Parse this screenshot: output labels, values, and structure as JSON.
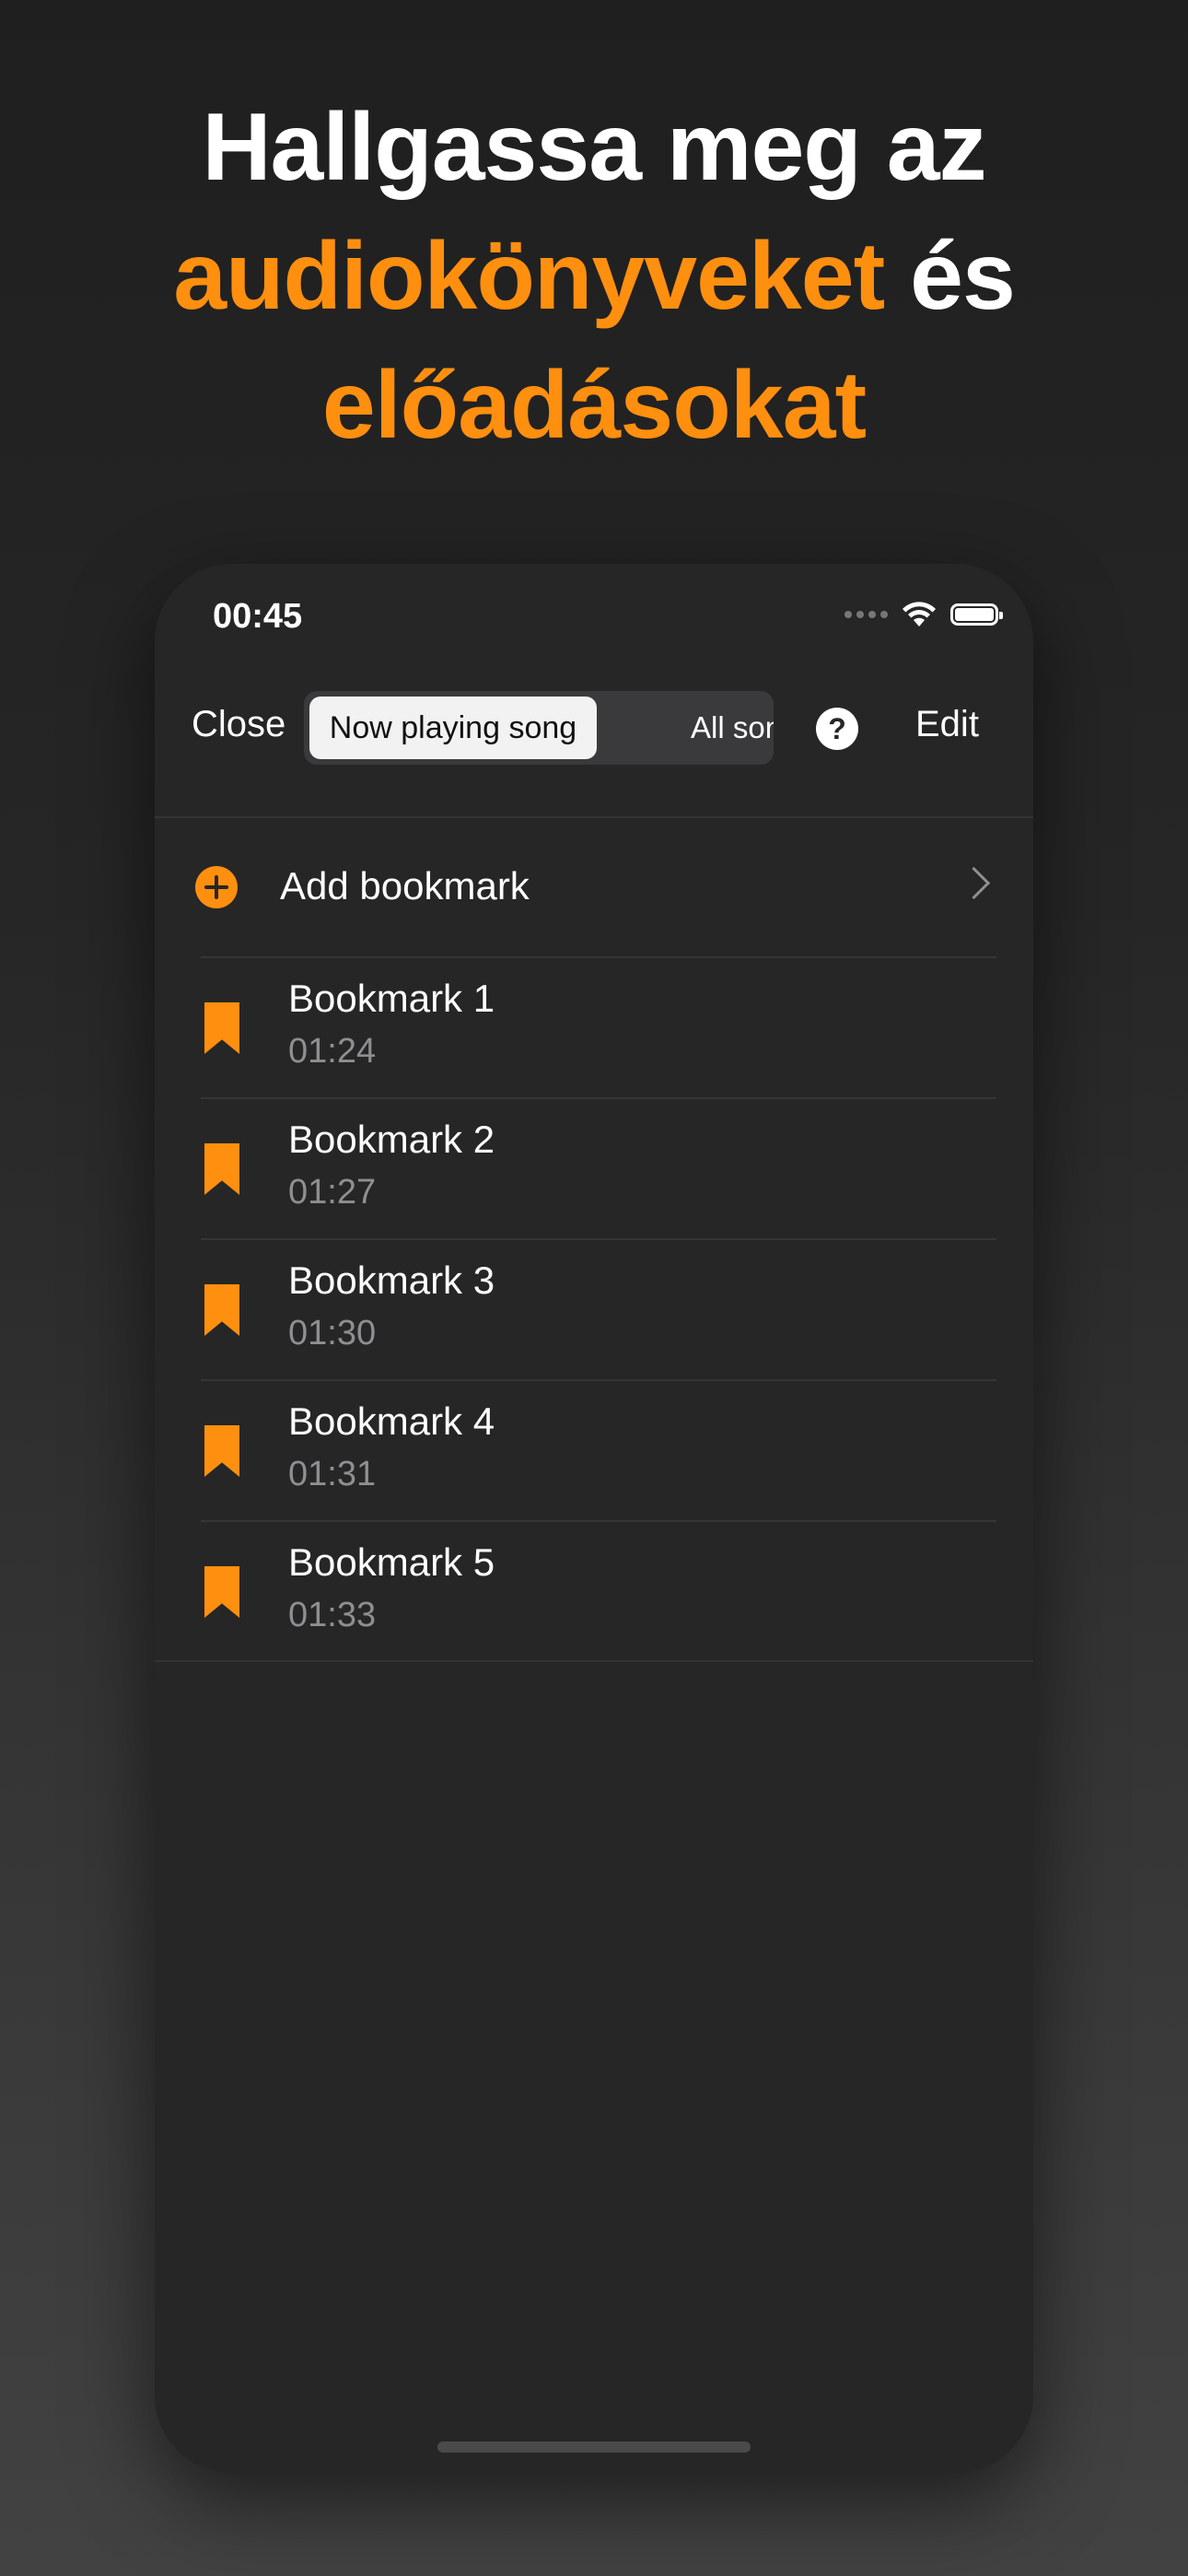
{
  "headline": {
    "line1": "Hallgassa meg az",
    "accent1": "audiokönyveket",
    "connector": " és",
    "accent2": "előadásokat"
  },
  "status_bar": {
    "time": "00:45"
  },
  "navbar": {
    "close_label": "Close",
    "segments": [
      "Now playing song",
      "All songs"
    ],
    "selected_segment": "Now playing song",
    "help_label": "?",
    "edit_label": "Edit"
  },
  "add_bookmark": {
    "label": "Add bookmark"
  },
  "bookmarks": [
    {
      "title": "Bookmark 1",
      "time": "01:24"
    },
    {
      "title": "Bookmark 2",
      "time": "01:27"
    },
    {
      "title": "Bookmark 3",
      "time": "01:30"
    },
    {
      "title": "Bookmark 4",
      "time": "01:31"
    },
    {
      "title": "Bookmark 5",
      "time": "01:33"
    }
  ],
  "colors": {
    "accent": "#ff8f0f",
    "panel": "#262626",
    "secondary_text": "#8e8e93"
  }
}
